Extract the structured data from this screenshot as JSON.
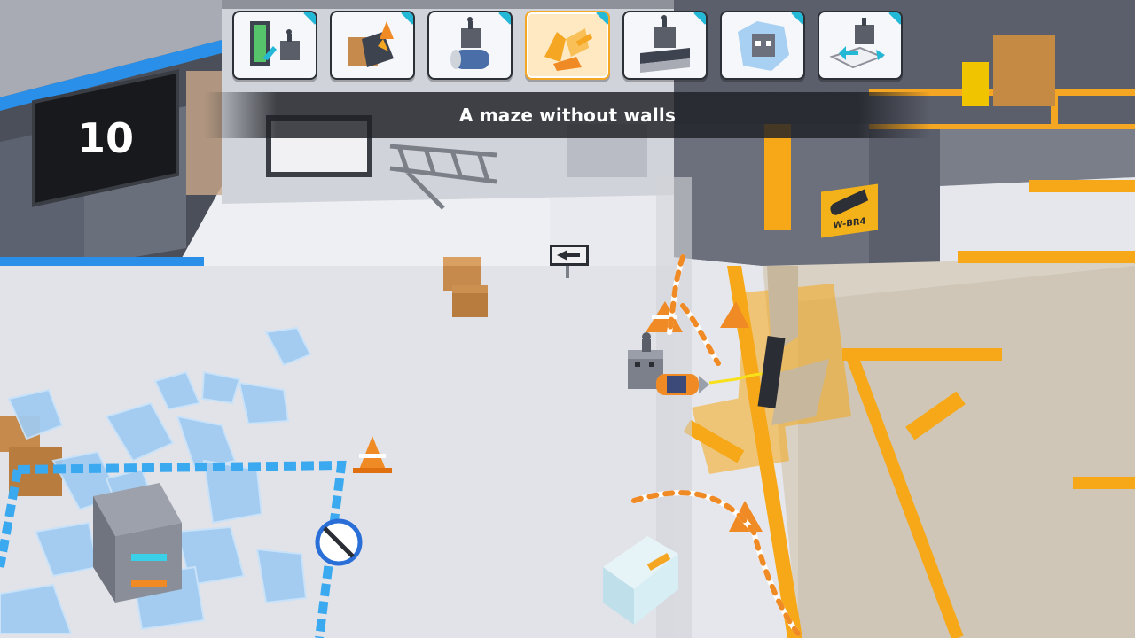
{
  "level": {
    "number": "10"
  },
  "subtitle": {
    "text": "A maze without walls"
  },
  "wall_label": {
    "text": "W-BR4"
  },
  "toolbar": {
    "cards": [
      {
        "icon": "exit-door-robot-icon",
        "selected": false
      },
      {
        "icon": "hazard-crate-icon",
        "selected": false
      },
      {
        "icon": "robot-on-barrel-icon",
        "selected": false
      },
      {
        "icon": "broken-wall-icon",
        "selected": true
      },
      {
        "icon": "robot-on-crusher-icon",
        "selected": false
      },
      {
        "icon": "frozen-robot-icon",
        "selected": false
      },
      {
        "icon": "robot-on-platform-icon",
        "selected": false
      }
    ]
  },
  "colors": {
    "floor": "#e4e6ec",
    "accent_orange": "#f5a623",
    "accent_blue": "#22b8d6",
    "dark_panel": "#17191d",
    "ice": "#9fcbf2"
  }
}
